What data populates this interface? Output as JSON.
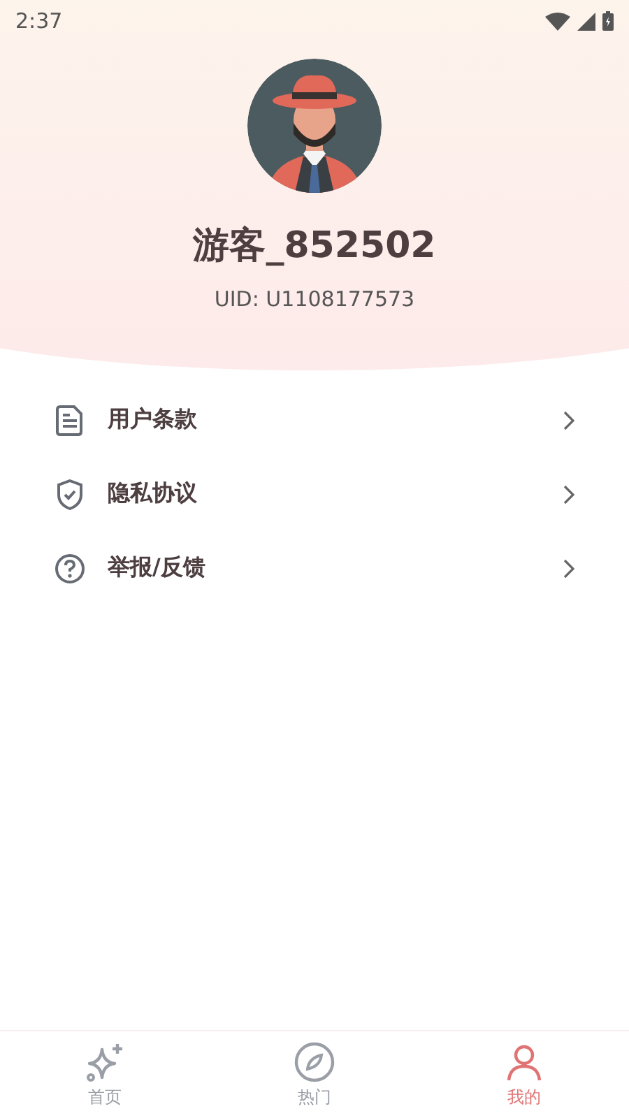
{
  "status_bar": {
    "time": "2:37"
  },
  "profile": {
    "name": "游客_852502",
    "uid": "UID: U1108177573"
  },
  "menu": [
    {
      "kind": "terms",
      "label": "用户条款"
    },
    {
      "kind": "privacy",
      "label": "隐私协议"
    },
    {
      "kind": "feedback",
      "label": "举报/反馈"
    }
  ],
  "tabs": [
    {
      "kind": "home",
      "label": "首页",
      "selected": false
    },
    {
      "kind": "hot",
      "label": "热门",
      "selected": false
    },
    {
      "kind": "mine",
      "label": "我的",
      "selected": true
    }
  ]
}
